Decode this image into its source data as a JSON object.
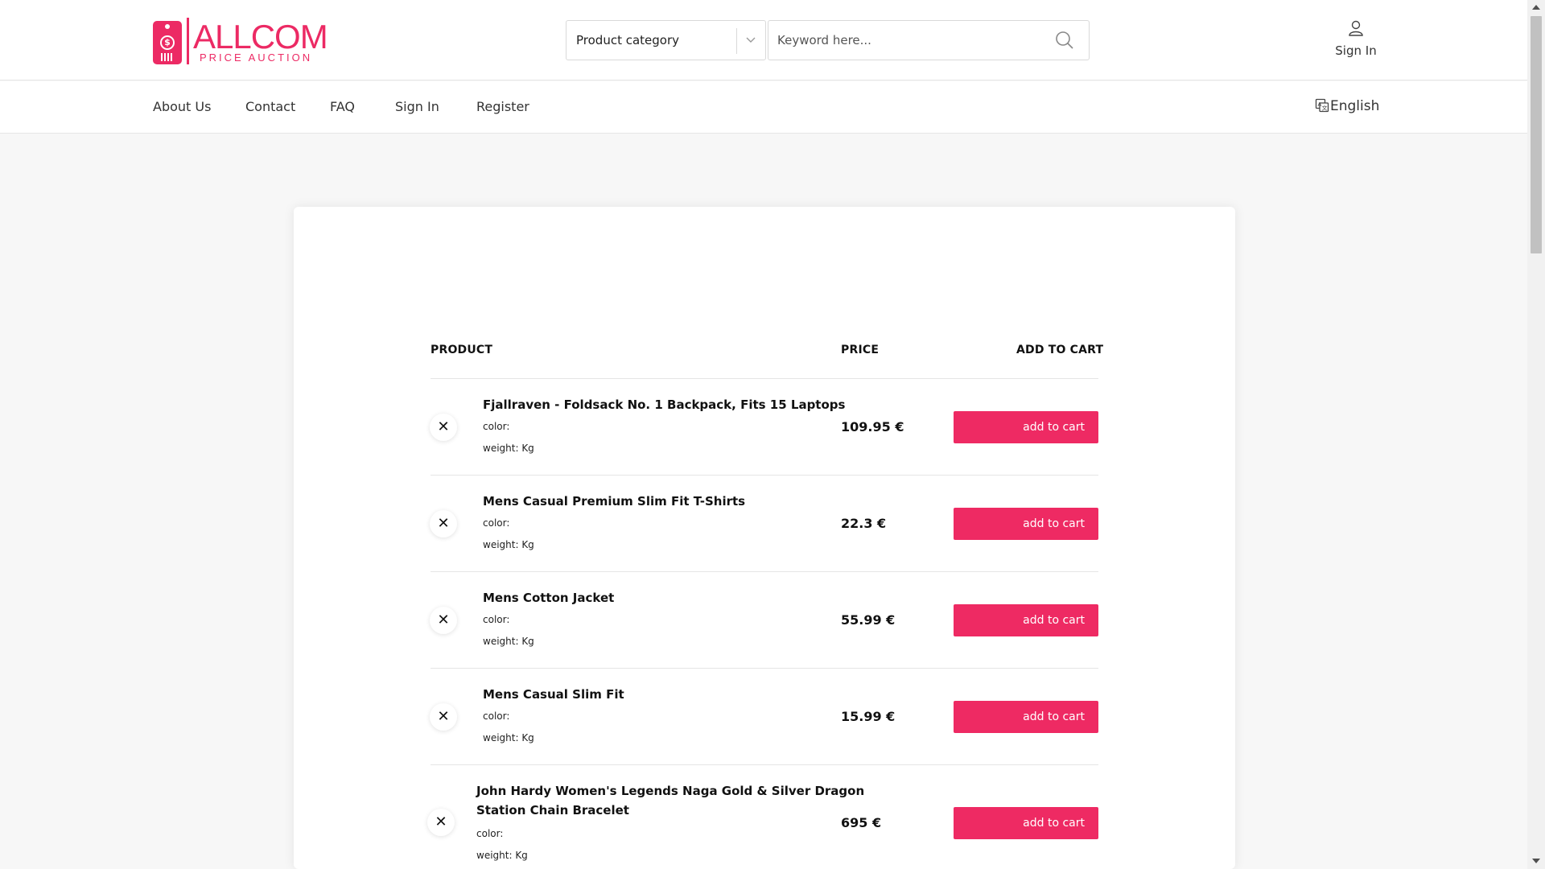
{
  "brand": {
    "name": "ALLCOM",
    "tagline": "PRICE AUCTION",
    "logo_symbol": "$",
    "accent_color": "#ec2a64"
  },
  "search": {
    "category_label": "Product category",
    "keyword_placeholder": "Keyword here..."
  },
  "account": {
    "sign_in_label": "Sign In"
  },
  "nav": {
    "links": [
      "About Us",
      "Contact",
      "FAQ",
      "Sign In",
      "Register"
    ],
    "language": "English"
  },
  "wishlist": {
    "headers": {
      "product": "PRODUCT",
      "price": "PRICE",
      "add_to_cart": "ADD TO CART"
    },
    "items": [
      {
        "name_lines": [
          "Fjallraven - Foldsack No. 1 Backpack, Fits 15 Laptops"
        ],
        "color": "color:",
        "weight": "weight: Kg",
        "price": "109.95 €",
        "button": "add to cart"
      },
      {
        "name_lines": [
          "Mens Casual Premium Slim Fit T-Shirts"
        ],
        "color": "color:",
        "weight": "weight: Kg",
        "price": "22.3 €",
        "button": "add to cart"
      },
      {
        "name_lines": [
          "Mens Cotton Jacket"
        ],
        "color": "color:",
        "weight": "weight: Kg",
        "price": "55.99 €",
        "button": "add to cart"
      },
      {
        "name_lines": [
          "Mens Casual Slim Fit"
        ],
        "color": "color:",
        "weight": "weight: Kg",
        "price": "15.99 €",
        "button": "add to cart"
      },
      {
        "name_lines": [
          "John Hardy Women's Legends Naga Gold & Silver Dragon",
          "Station Chain Bracelet"
        ],
        "color": "color:",
        "weight": "weight: Kg",
        "price": "695 €",
        "button": "add to cart"
      }
    ]
  },
  "icons": {
    "search": "search-icon",
    "user": "user-icon",
    "translate": "translate-icon",
    "dropdown": "chevron-down-icon",
    "remove": "close-icon"
  }
}
